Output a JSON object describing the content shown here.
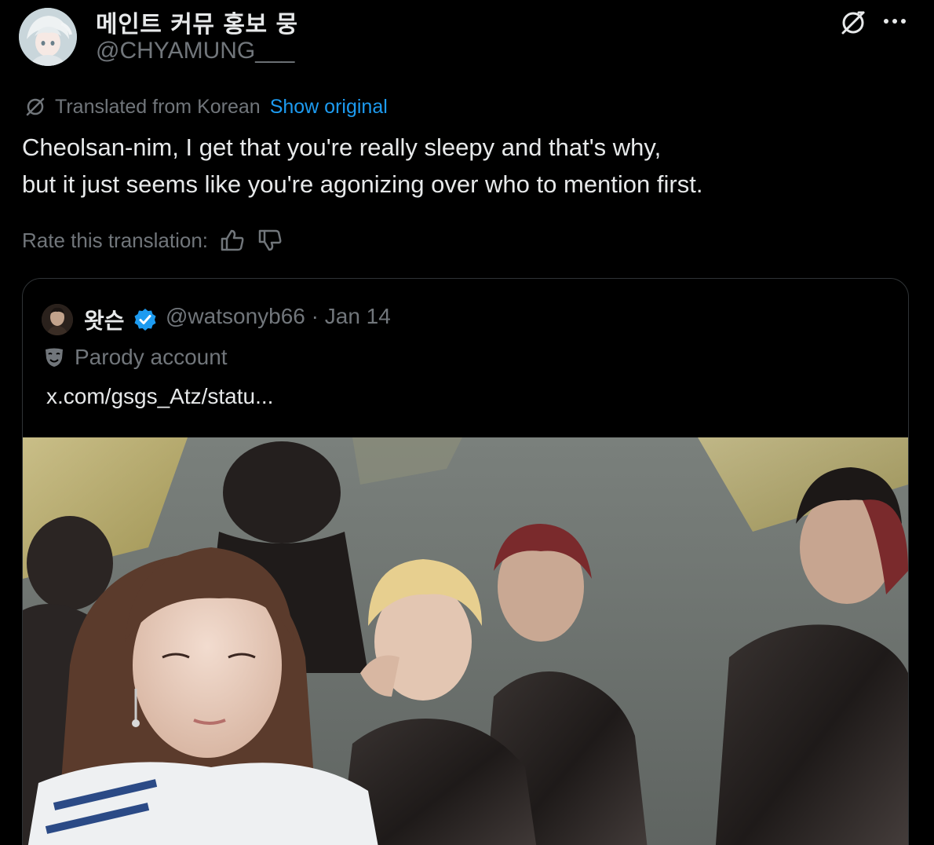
{
  "author": {
    "display_name": "메인트 커뮤 홍보 뭉",
    "handle": "@CHYAMUNG___"
  },
  "translation": {
    "translated_label": "Translated from Korean",
    "show_original_label": "Show original"
  },
  "tweet": {
    "lines": [
      "Cheolsan-nim, I get that you're really sleepy and that's why,",
      "but it just seems like you're agonizing over who to mention first."
    ]
  },
  "rate": {
    "label": "Rate this translation:"
  },
  "quote": {
    "display_name": "왓슨",
    "handle_date": "@watsonyb66 · Jan 14",
    "parody_label": "Parody account",
    "link_text": "x.com/gsgs_Atz/statu..."
  },
  "icons": {
    "top_translate": "translate-icon",
    "more": "more-icon",
    "thumbs_up": "thumbs-up-icon",
    "thumbs_down": "thumbs-down-icon",
    "verified": "verified-badge-icon",
    "parody": "parody-mask-icon"
  },
  "colors": {
    "background": "#000000",
    "primary_text": "#e7e9ea",
    "secondary_text": "#71767b",
    "link_blue": "#1d9bf0",
    "border": "#2f3336"
  }
}
